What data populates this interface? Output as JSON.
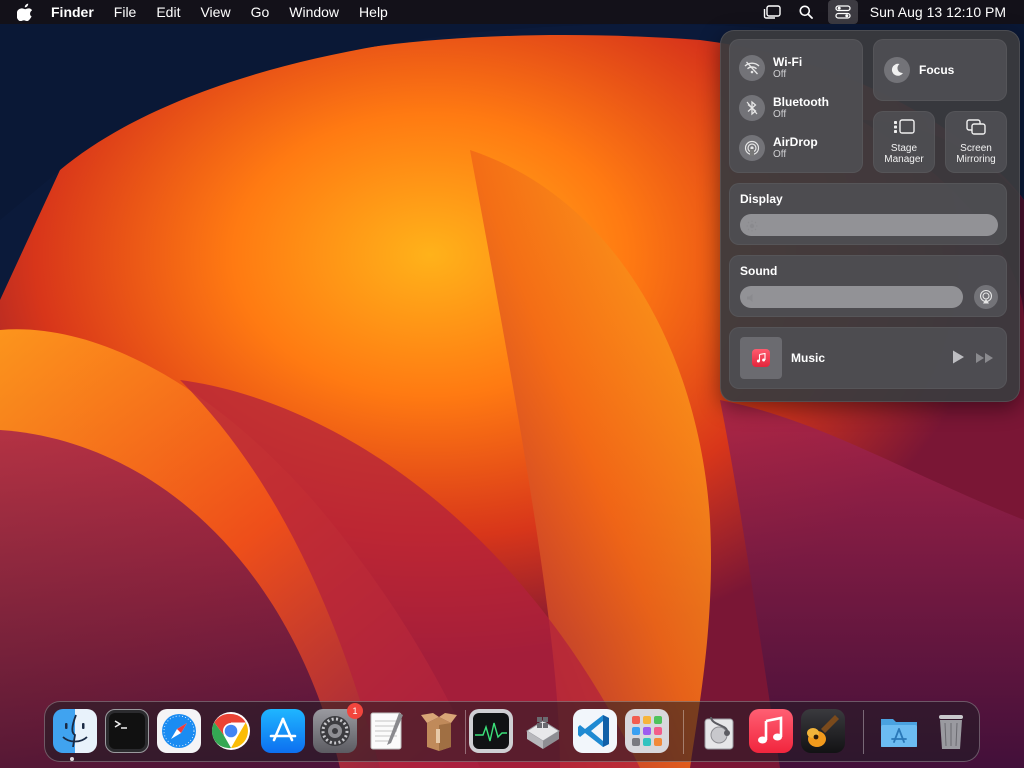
{
  "menubar": {
    "app_name": "Finder",
    "menus": [
      "File",
      "Edit",
      "View",
      "Go",
      "Window",
      "Help"
    ],
    "clock": "Sun Aug 13  12:10 PM",
    "icons": [
      "apple-icon",
      "stage-manager-icon",
      "spotlight-search-icon",
      "control-center-icon"
    ]
  },
  "control_center": {
    "wifi": {
      "label": "Wi-Fi",
      "status": "Off"
    },
    "bluetooth": {
      "label": "Bluetooth",
      "status": "Off"
    },
    "airdrop": {
      "label": "AirDrop",
      "status": "Off"
    },
    "focus": {
      "label": "Focus"
    },
    "stage_manager": {
      "line1": "Stage",
      "line2": "Manager"
    },
    "screen_mirroring": {
      "line1": "Screen",
      "line2": "Mirroring"
    },
    "display": {
      "label": "Display",
      "level": 0.0
    },
    "sound": {
      "label": "Sound",
      "level": 0.0
    },
    "now_playing": {
      "label": "Music"
    }
  },
  "dock": {
    "items": [
      {
        "name": "Finder",
        "icon": "finder-icon",
        "running": true
      },
      {
        "name": "Terminal",
        "icon": "terminal-icon"
      },
      {
        "name": "Safari",
        "icon": "safari-icon"
      },
      {
        "name": "Google Chrome",
        "icon": "chrome-icon"
      },
      {
        "name": "App Store",
        "icon": "app-store-icon"
      },
      {
        "name": "System Settings",
        "icon": "system-settings-icon",
        "badge": "1"
      },
      {
        "name": "TextEdit",
        "icon": "textedit-icon"
      },
      {
        "name": "Archive Utility",
        "icon": "archive-utility-icon"
      },
      {
        "name": "Activity Monitor",
        "icon": "activity-monitor-icon"
      },
      {
        "name": "Boot Camp Assistant",
        "icon": "boot-camp-icon"
      },
      {
        "name": "Visual Studio Code",
        "icon": "vscode-icon"
      },
      {
        "name": "Launchpad",
        "icon": "launchpad-icon"
      },
      {
        "name": "Disk Utility",
        "icon": "disk-utility-icon"
      },
      {
        "name": "Music",
        "icon": "music-icon"
      },
      {
        "name": "GarageBand",
        "icon": "garageband-icon"
      },
      {
        "name": "Applications",
        "icon": "applications-folder-icon"
      },
      {
        "name": "Trash",
        "icon": "trash-icon"
      }
    ]
  },
  "colors": {
    "accent_red": "#f2453d",
    "menubar_bg": "#161014",
    "panel_bg": "#3a3a3e"
  }
}
